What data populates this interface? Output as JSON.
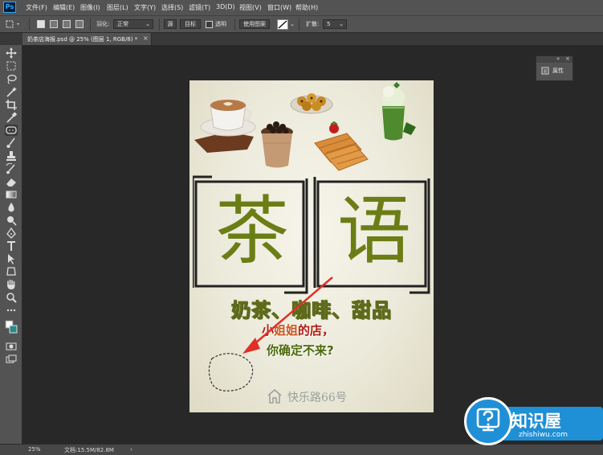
{
  "app": {
    "logo": "Ps"
  },
  "menu": [
    "文件(F)",
    "编辑(E)",
    "图像(I)",
    "图层(L)",
    "文字(Y)",
    "选择(S)",
    "滤镜(T)",
    "3D(D)",
    "视图(V)",
    "窗口(W)",
    "帮助(H)"
  ],
  "options": {
    "feather_label": "羽化:",
    "mode_value": "正常",
    "source_button": "源",
    "target_button": "目标",
    "transparent_label": "透明",
    "use_pattern_button": "使用图案",
    "diffuse_label": "扩散:",
    "diffuse_value": "5"
  },
  "document_tab": {
    "label": "奶茶店海报.psd @ 25% (图层 1, RGB/8) *",
    "close": "×"
  },
  "poster": {
    "char_left": "茶",
    "char_right": "语",
    "slogan_line1": "奶茶、咖啡、甜品",
    "slogan_line2_a": "小",
    "slogan_line2_b": "姐姐",
    "slogan_line2_c": "的店，",
    "slogan_line3": "你确定不来?",
    "address": "快乐路66号",
    "colors": {
      "accent_green": "#6b7e16",
      "red_text": "#b01c12",
      "arrow": "#e0302a"
    }
  },
  "panels": {
    "properties_label": "属性",
    "collapse": "»",
    "close": "×"
  },
  "status": {
    "zoom": "25%",
    "doc": "文档:15.5M/82.8M",
    "arrow": "›"
  },
  "watermark": {
    "title": "知识屋",
    "subtitle": "zhishiwu.com"
  },
  "tools": [
    "move-icon",
    "marquee-icon",
    "lasso-icon",
    "magic-wand-icon",
    "crop-icon",
    "eyedropper-icon",
    "patch-icon",
    "brush-icon",
    "stamp-icon",
    "history-brush-icon",
    "eraser-icon",
    "gradient-icon",
    "blur-icon",
    "dodge-icon",
    "pen-icon",
    "type-icon",
    "path-select-icon",
    "shape-icon",
    "hand-icon",
    "zoom-icon",
    "more-tools-icon",
    "color-swatches",
    "quick-mask-icon",
    "screen-mode-icon"
  ]
}
